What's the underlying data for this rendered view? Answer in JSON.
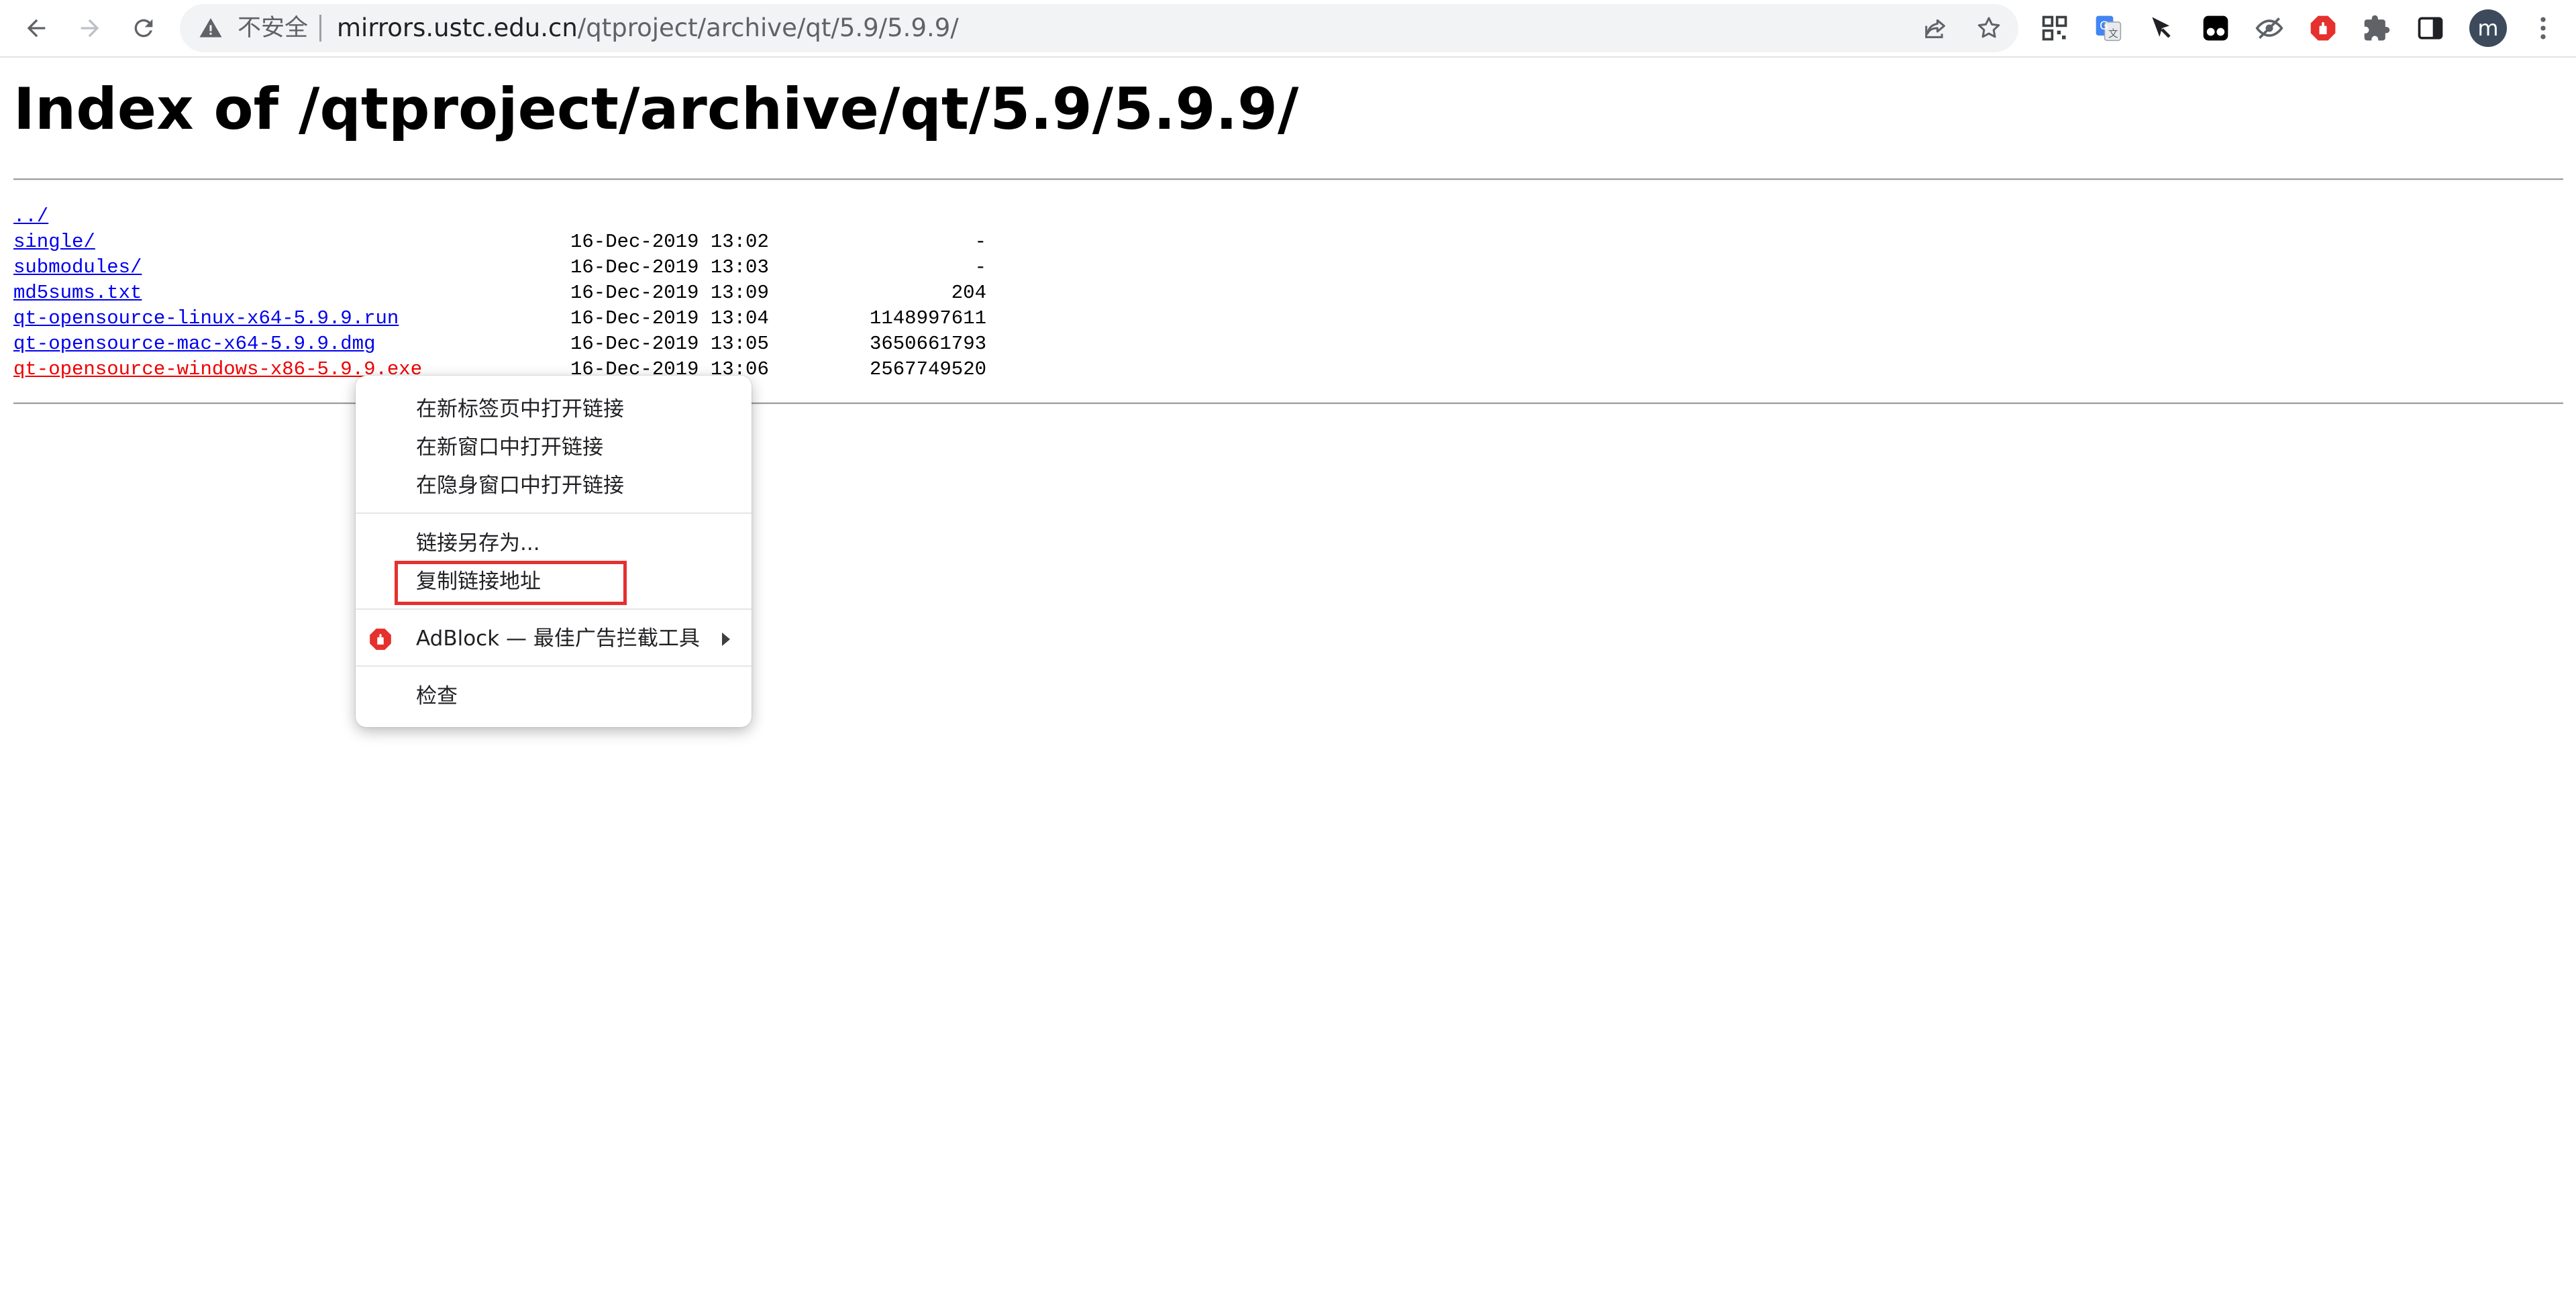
{
  "browser": {
    "security_label": "不安全",
    "url_host": "mirrors.ustc.edu.cn",
    "url_path": "/qtproject/archive/qt/5.9/5.9.9/",
    "avatar_letter": "m",
    "extensions": [
      "qr-code-icon",
      "google-translate-icon",
      "cursor-icon",
      "tampermonkey-icon",
      "eye-slash-icon",
      "adblock-icon",
      "puzzle-icon",
      "side-panel-icon"
    ]
  },
  "page": {
    "title": "Index of /qtproject/archive/qt/5.9/5.9.9/",
    "parent_link": "../",
    "entries": [
      {
        "name": "single/",
        "date": "16-Dec-2019 13:02",
        "size": "-"
      },
      {
        "name": "submodules/",
        "date": "16-Dec-2019 13:03",
        "size": "-"
      },
      {
        "name": "md5sums.txt",
        "date": "16-Dec-2019 13:09",
        "size": "204"
      },
      {
        "name": "qt-opensource-linux-x64-5.9.9.run",
        "date": "16-Dec-2019 13:04",
        "size": "1148997611"
      },
      {
        "name": "qt-opensource-mac-x64-5.9.9.dmg",
        "date": "16-Dec-2019 13:05",
        "size": "3650661793"
      },
      {
        "name": "qt-opensource-windows-x86-5.9.9.exe",
        "date": "16-Dec-2019 13:06",
        "size": "2567749520"
      }
    ]
  },
  "context_menu": {
    "open_new_tab": "在新标签页中打开链接",
    "open_new_window": "在新窗口中打开链接",
    "open_incognito": "在隐身窗口中打开链接",
    "save_link_as": "链接另存为...",
    "copy_link": "复制链接地址",
    "adblock": "AdBlock — 最佳广告拦截工具",
    "inspect": "检查"
  },
  "colors": {
    "link": "#0000ee",
    "active_link": "#ee0000",
    "highlight_box": "#e5302d",
    "adblock_red": "#e5302d"
  }
}
